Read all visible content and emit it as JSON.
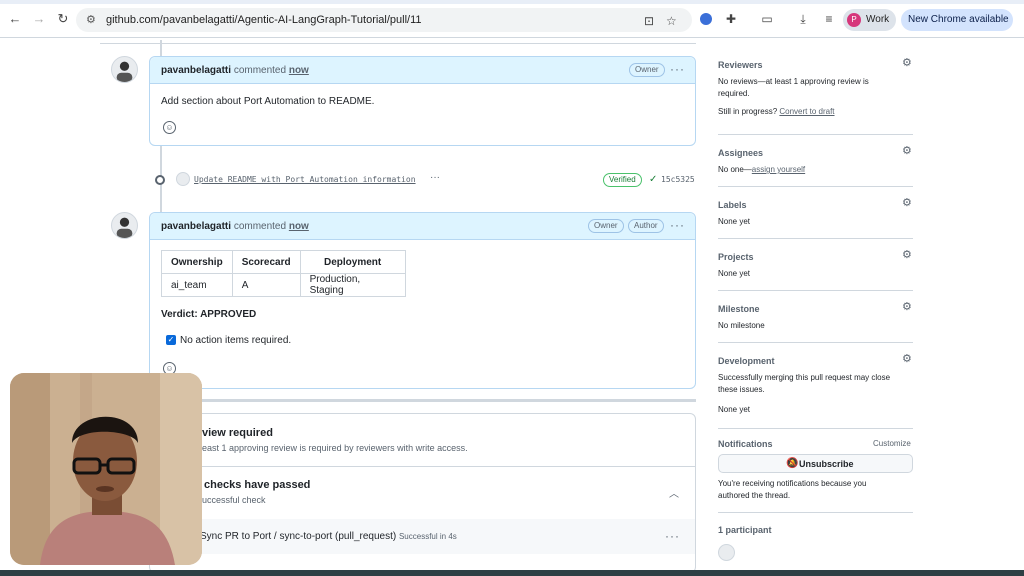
{
  "browser": {
    "url": "github.com/pavanbelagatti/Agentic-AI-LangGraph-Tutorial/pull/11",
    "profile_initial": "P",
    "profile_label": "Work",
    "update_label": "New Chrome available"
  },
  "comments": [
    {
      "author": "pavanbelagatti",
      "verb": "commented",
      "time": "now",
      "badges": [
        "Owner"
      ],
      "body": "Add section about Port Automation to README."
    },
    {
      "author": "pavanbelagatti",
      "verb": "commented",
      "time": "now",
      "badges": [
        "Owner",
        "Author"
      ],
      "table": {
        "headers": [
          "Ownership",
          "Scorecard",
          "Deployment"
        ],
        "rows": [
          [
            "ai_team",
            "A",
            "Production, Staging"
          ]
        ]
      },
      "verdict": "Verdict: APPROVED",
      "checkbox_label": "No action items required."
    }
  ],
  "commit": {
    "message": "Update README with Port Automation information",
    "more": "···",
    "verified": "Verified",
    "sha": "15c5325"
  },
  "merge": {
    "review_title": "view required",
    "review_sub": "east 1 approving review is required by reviewers with write access.",
    "checks_title": "checks have passed",
    "checks_sub": "uccessful check",
    "check_name": "Sync PR to Port / sync-to-port (pull_request)",
    "check_status": "Successful in 4s"
  },
  "sidebar": {
    "reviewers": {
      "title": "Reviewers",
      "text": "No reviews—at least 1 approving review is required.",
      "progress_prefix": "Still in progress?",
      "progress_link": "Convert to draft"
    },
    "assignees": {
      "title": "Assignees",
      "prefix": "No one—",
      "link": "assign yourself"
    },
    "labels": {
      "title": "Labels",
      "text": "None yet"
    },
    "projects": {
      "title": "Projects",
      "text": "None yet"
    },
    "milestone": {
      "title": "Milestone",
      "text": "No milestone"
    },
    "development": {
      "title": "Development",
      "text": "Successfully merging this pull request may close these issues.",
      "none": "None yet"
    },
    "notifications": {
      "title": "Notifications",
      "customize": "Customize",
      "button": "Unsubscribe",
      "text": "You're receiving notifications because you authored the thread."
    },
    "participants": {
      "title": "1 participant"
    }
  },
  "colors": {
    "accent": "#0969da",
    "success": "#1a7f37",
    "comment_header": "#ddf4ff"
  }
}
